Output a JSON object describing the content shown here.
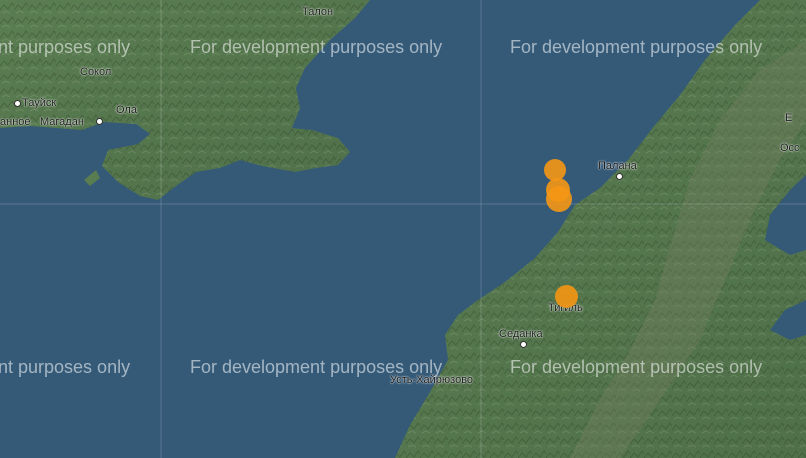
{
  "map": {
    "watermark_text": "For development purposes only",
    "watermark_text_left": "nt purposes only",
    "cities": {
      "tauisk": "Тауйск",
      "ola": "Ола",
      "magadan": "Магадан",
      "sokol": "Сокол",
      "annoe": "анное",
      "palana": "Палана",
      "tigil": "Тигиль",
      "sedanka": "Седанка",
      "ust_khairyuzovo": "Усть-Хайрюзово",
      "right_edge_1": "E",
      "right_edge_2": "Осс",
      "top_partial": "Талон"
    },
    "colors": {
      "water": "#345a78",
      "land": "#5c7f56",
      "mountains": "#6e8160",
      "marker": "#f5961e"
    },
    "markers": [
      "event-marker-1",
      "event-marker-2",
      "event-marker-3",
      "event-marker-4"
    ]
  }
}
